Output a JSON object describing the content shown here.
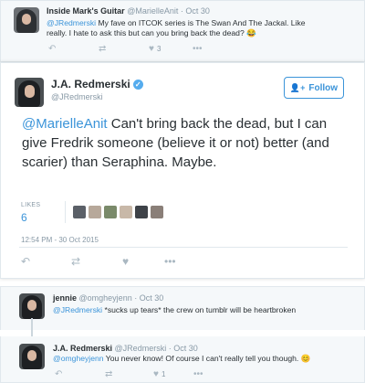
{
  "reply1": {
    "name": "Inside Mark's Guitar",
    "meta": "@MarielleAnit · Oct 30",
    "mention": "@JRedmerski",
    "line1": " My fave on ITCOK series is The Swan And The Jackal. Like",
    "line2": "really. I hate to ask this but can you bring back the dead? 😂",
    "like_count": "3"
  },
  "main": {
    "name": "J.A. Redmerski",
    "handle": "@JRedmerski",
    "follow_label": "Follow",
    "mention": "@MarielleAnit",
    "text_after_mention": " Can't bring back the dead, but I  can give Fredrik someone (believe it or not) better (and scarier) than Seraphina. Maybe.",
    "likes_label": "LIKES",
    "likes_count": "6",
    "likers": [
      "#5b6068",
      "#b7a89a",
      "#7a8a6a",
      "#c8b8a8",
      "#3e4248",
      "#8a7f78"
    ],
    "timestamp": "12:54 PM - 30 Oct 2015"
  },
  "reply2": {
    "name": "jennie",
    "meta": "@omgheyjenn · Oct 30",
    "mention": "@JRedmerski",
    "text": " *sucks up tears* the crew on tumblr will be heartbroken"
  },
  "reply3": {
    "name": "J.A. Redmerski",
    "meta": "@JRedmerski · Oct 30",
    "mention": "@omgheyjenn",
    "text": " You never know! Of course I can't really tell you though. 😊",
    "like_count": "1"
  },
  "colors": {
    "link": "#3b94d9",
    "muted": "#8899a6",
    "verified": "#55acee"
  },
  "icons": [
    "reply-icon",
    "retweet-icon",
    "like-icon",
    "more-icon",
    "follow-person-icon",
    "verified-badge-icon"
  ]
}
